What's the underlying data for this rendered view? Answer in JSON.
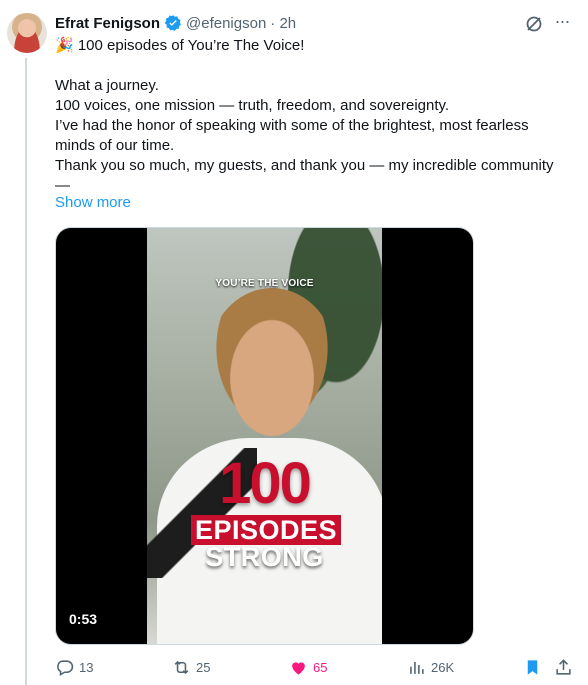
{
  "author": {
    "name": "Efrat Fenigson",
    "handle": "@efenigson",
    "time": "· 2h"
  },
  "tweet": {
    "lines": [
      "🎉 100 episodes of You’re The Voice!",
      "",
      "What a journey.",
      "100 voices, one mission — truth, freedom, and sovereignty.",
      "I’ve had the honor of speaking with some of the brightest, most fearless minds of our time.",
      "Thank you so much, my guests, and thank you — my incredible community —"
    ],
    "show_more": "Show more"
  },
  "media": {
    "overlay_label": "YOU’RE THE VOICE",
    "big_number": "100",
    "line1": "EPISODES",
    "line2": "STRONG",
    "duration": "0:53"
  },
  "actions": {
    "replies": "13",
    "reposts": "25",
    "likes": "65",
    "views": "26K"
  },
  "colors": {
    "accent": "#1d9bf0",
    "like": "#f91880",
    "muted": "#536471",
    "brand_red": "#c8102e"
  }
}
